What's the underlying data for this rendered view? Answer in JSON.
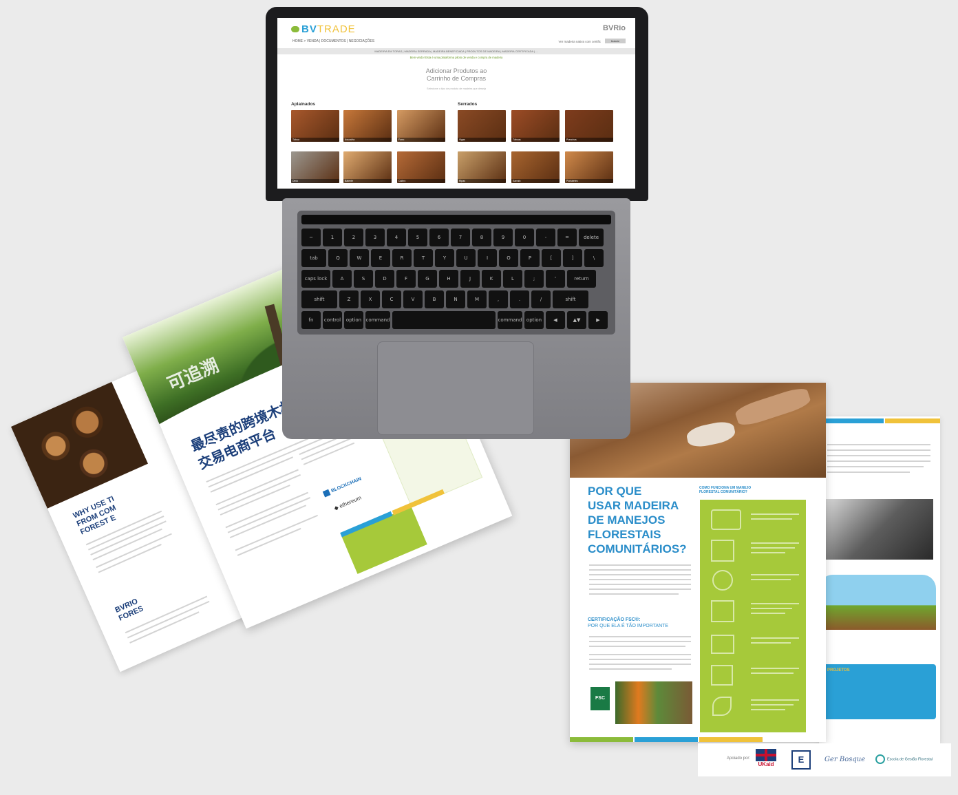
{
  "site": {
    "logo_bv": "BV",
    "logo_trade": "TRADE",
    "logo_right": "BVRio",
    "nav": "HOME  >  VENDA  |  DOCUMENTOS  |  NEGOCIAÇÕES",
    "search_text": "Ver madeira nativa com certific",
    "search_button": "buscar",
    "menu": "MADEIRA EM TORAS  |  MADEIRA SERRADA  |  MADEIRA BENEFICIADA  |  PRODUTOS DE MADEIRA  |  MADEIRA CERTIFICADA  |  ...",
    "notice": "Bem-vindo! Esta é uma plataforma piloto de venda e compra de madeira",
    "heading_line1": "Adicionar Produtos ao",
    "heading_line2": "Carrinho de Compras",
    "subheading": "Selecione o tipo de produto de madeira que deseja",
    "section_left": "Aplainados",
    "section_right": "Serrados",
    "tiles": [
      {
        "label": "Tábua",
        "color": "#a8582c"
      },
      {
        "label": "Assoalho",
        "color": "#c7783a"
      },
      {
        "label": "Forro",
        "color": "#d49a62"
      },
      {
        "label": "Vigas",
        "color": "#8a4a25"
      },
      {
        "label": "Tábuas",
        "color": "#9c4c26"
      },
      {
        "label": "Pranchas",
        "color": "#7e3c1d"
      },
      {
        "label": "Deck",
        "color": "#9c9890"
      },
      {
        "label": "Batente",
        "color": "#e0ab70"
      },
      {
        "label": "Caibro",
        "color": "#b56a37"
      },
      {
        "label": "Ripas",
        "color": "#c9a06a"
      },
      {
        "label": "Sarrafo",
        "color": "#a8652f"
      },
      {
        "label": "Pontaletes",
        "color": "#d08a4b"
      }
    ]
  },
  "keyboard": {
    "rows": [
      [
        "~",
        "1",
        "2",
        "3",
        "4",
        "5",
        "6",
        "7",
        "8",
        "9",
        "0",
        "-",
        "=",
        "delete"
      ],
      [
        "tab",
        "Q",
        "W",
        "E",
        "R",
        "T",
        "Y",
        "U",
        "I",
        "O",
        "P",
        "[",
        "]",
        "\\"
      ],
      [
        "caps lock",
        "A",
        "S",
        "D",
        "F",
        "G",
        "H",
        "J",
        "K",
        "L",
        ";",
        "'",
        "return"
      ],
      [
        "shift",
        "Z",
        "X",
        "C",
        "V",
        "B",
        "N",
        "M",
        ",",
        ".",
        "/",
        "shift"
      ],
      [
        "fn",
        "control",
        "option",
        "command",
        "",
        "command",
        "option",
        "◀",
        "▲▼",
        "▶"
      ]
    ]
  },
  "left_brochure": {
    "zh_line1": "最尽责的跨境木材",
    "zh_line2": "交易电商平台",
    "zh_vertical": "可追溯",
    "back_title_line1": "WHY USE TI",
    "back_title_line2": "FROM COM",
    "back_title_line3": "FOREST E",
    "back_footer_line1": "BVRIO",
    "back_footer_line2": "FORES",
    "logo_blockchain": "BLOCKCHAIN",
    "logo_ethereum": "ethereum"
  },
  "right_brochure": {
    "title_line1": "POR QUE",
    "title_line2": "USAR MADEIRA",
    "title_line3": "DE MANEJOS",
    "title_line4": "FLORESTAIS",
    "title_line5": "COMUNITÁRIOS?",
    "sub_line1": "COMO FUNCIONA UM MANEJO",
    "sub_line2": "FLORESTAL COMUNITÁRIO?",
    "cert_line1": "CERTIFICAÇÃO FSC®:",
    "cert_line2": "POR QUE ELA É TÃO IMPORTANTE",
    "fsc_label": "FSC",
    "blue_box_title": "PROJETOS"
  },
  "partners": {
    "label": "Apoiado por:",
    "ukaid": "UKaid",
    "e_logo": "E",
    "script_logo": "Ger Bosque",
    "circle_logo": "Escola de Gestão Florestal"
  }
}
